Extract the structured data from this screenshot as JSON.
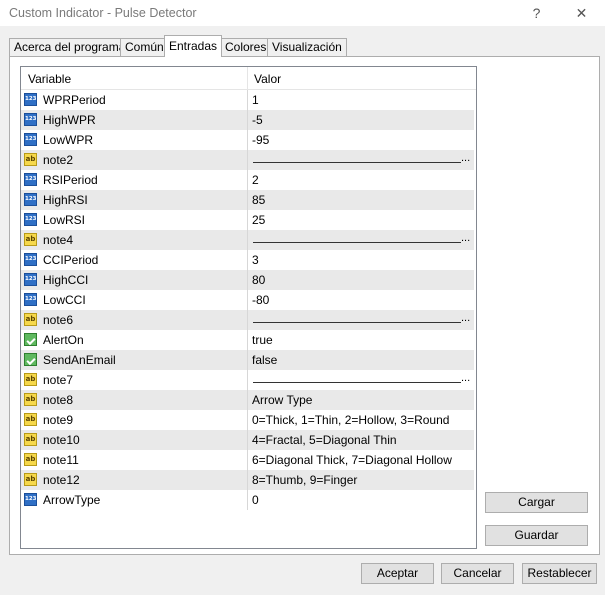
{
  "window": {
    "title": "Custom Indicator - Pulse Detector",
    "help_glyph": "?",
    "close_glyph": "✕"
  },
  "tabs": [
    "Acerca del programa",
    "Común",
    "Entradas",
    "Colores",
    "Visualización"
  ],
  "active_tab": "Entradas",
  "grid": {
    "col_variable": "Variable",
    "col_value": "Valor",
    "rows": [
      {
        "type": "num",
        "name": "WPRPeriod",
        "value": "1"
      },
      {
        "type": "num",
        "name": "HighWPR",
        "value": "-5"
      },
      {
        "type": "num",
        "name": "LowWPR",
        "value": "-95"
      },
      {
        "type": "str",
        "name": "note2",
        "value": "",
        "underline": true
      },
      {
        "type": "num",
        "name": "RSIPeriod",
        "value": "2"
      },
      {
        "type": "num",
        "name": "HighRSI",
        "value": "85"
      },
      {
        "type": "num",
        "name": "LowRSI",
        "value": "25"
      },
      {
        "type": "str",
        "name": "note4",
        "value": "",
        "underline": true
      },
      {
        "type": "num",
        "name": "CCIPeriod",
        "value": "3"
      },
      {
        "type": "num",
        "name": "HighCCI",
        "value": "80"
      },
      {
        "type": "num",
        "name": "LowCCI",
        "value": "-80"
      },
      {
        "type": "str",
        "name": "note6",
        "value": "",
        "underline": true
      },
      {
        "type": "bool",
        "name": "AlertOn",
        "value": "true"
      },
      {
        "type": "bool",
        "name": "SendAnEmail",
        "value": "false"
      },
      {
        "type": "str",
        "name": "note7",
        "value": "",
        "underline": true
      },
      {
        "type": "str",
        "name": "note8",
        "value": "Arrow Type"
      },
      {
        "type": "str",
        "name": "note9",
        "value": "0=Thick, 1=Thin, 2=Hollow, 3=Round"
      },
      {
        "type": "str",
        "name": "note10",
        "value": "4=Fractal, 5=Diagonal Thin"
      },
      {
        "type": "str",
        "name": "note11",
        "value": "6=Diagonal Thick, 7=Diagonal Hollow"
      },
      {
        "type": "str",
        "name": "note12",
        "value": "8=Thumb, 9=Finger"
      },
      {
        "type": "num",
        "name": "ArrowType",
        "value": "0"
      }
    ],
    "icon_text": {
      "num": "123",
      "str": "ab",
      "bool": ""
    },
    "ellipsis": "..."
  },
  "side_buttons": {
    "load": "Cargar",
    "save": "Guardar"
  },
  "footer_buttons": {
    "ok": "Aceptar",
    "cancel": "Cancelar",
    "reset": "Restablecer"
  }
}
